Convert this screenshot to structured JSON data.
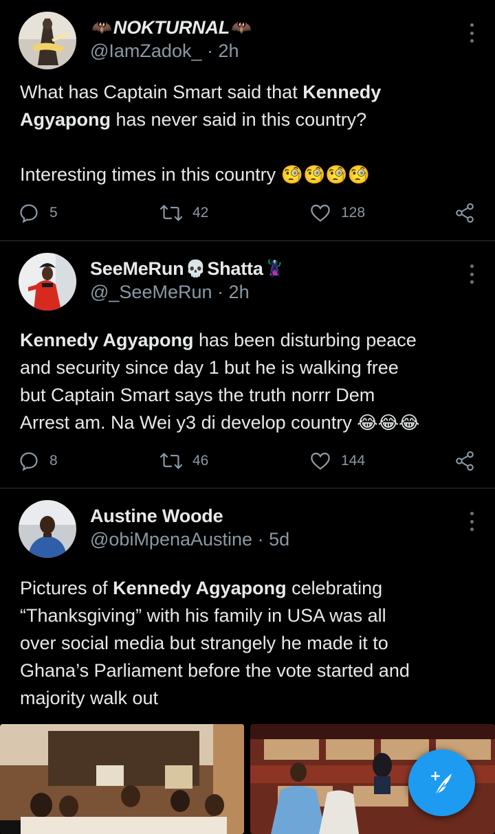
{
  "tweets": [
    {
      "display_name": "NOKTURNAL",
      "name_emoji_left": "🦇",
      "name_emoji_right": "🦇",
      "handle": "@IamZadok_",
      "time": "2h",
      "text_lines": [
        [
          {
            "t": "What has Captain Smart said that "
          },
          {
            "b": "Kennedy"
          }
        ],
        [
          {
            "b": "Agyapong"
          },
          {
            "t": " has never said in this country?"
          }
        ],
        [],
        [
          {
            "t": "Interesting times in this country "
          },
          {
            "e": "🧐🧐🧐🧐"
          }
        ]
      ],
      "replies": "5",
      "retweets": "42",
      "likes": "128"
    },
    {
      "display_name": "SeeMeRun",
      "name_emoji_mid": "💀",
      "display_name_2": "Shatta",
      "name_emoji_right": "🦹",
      "handle": "@_SeeMeRun",
      "time": "2h",
      "text_lines": [
        [
          {
            "b": "Kennedy Agyapong"
          },
          {
            "t": " has been disturbing peace"
          }
        ],
        [
          {
            "t": "and security since day 1 but he is walking free"
          }
        ],
        [
          {
            "t": "but Captain Smart says the truth norrr Dem"
          }
        ],
        [
          {
            "t": "Arrest am. Na Wei y3 di develop country "
          },
          {
            "e": "😂😂😂"
          }
        ]
      ],
      "replies": "8",
      "retweets": "46",
      "likes": "144"
    },
    {
      "display_name": "Austine Woode",
      "handle": "@obiMpenaAustine",
      "time": "5d",
      "text_lines": [
        [
          {
            "t": "Pictures of "
          },
          {
            "b": "Kennedy Agyapong"
          },
          {
            "t": " celebrating"
          }
        ],
        [
          {
            "t": "“Thanksgiving” with his family in USA was all"
          }
        ],
        [
          {
            "t": "over social media but strangely he made it to"
          }
        ],
        [
          {
            "t": "Ghana’s Parliament before the vote started and"
          }
        ],
        [
          {
            "t": "majority walk out"
          }
        ]
      ]
    }
  ],
  "separator": "·",
  "fab": {
    "label": "+",
    "icon": "feather-icon"
  },
  "colors": {
    "accent": "#1d9bf0",
    "background": "#000000",
    "secondary_text": "#8b98a5",
    "divider": "#2f3336"
  }
}
